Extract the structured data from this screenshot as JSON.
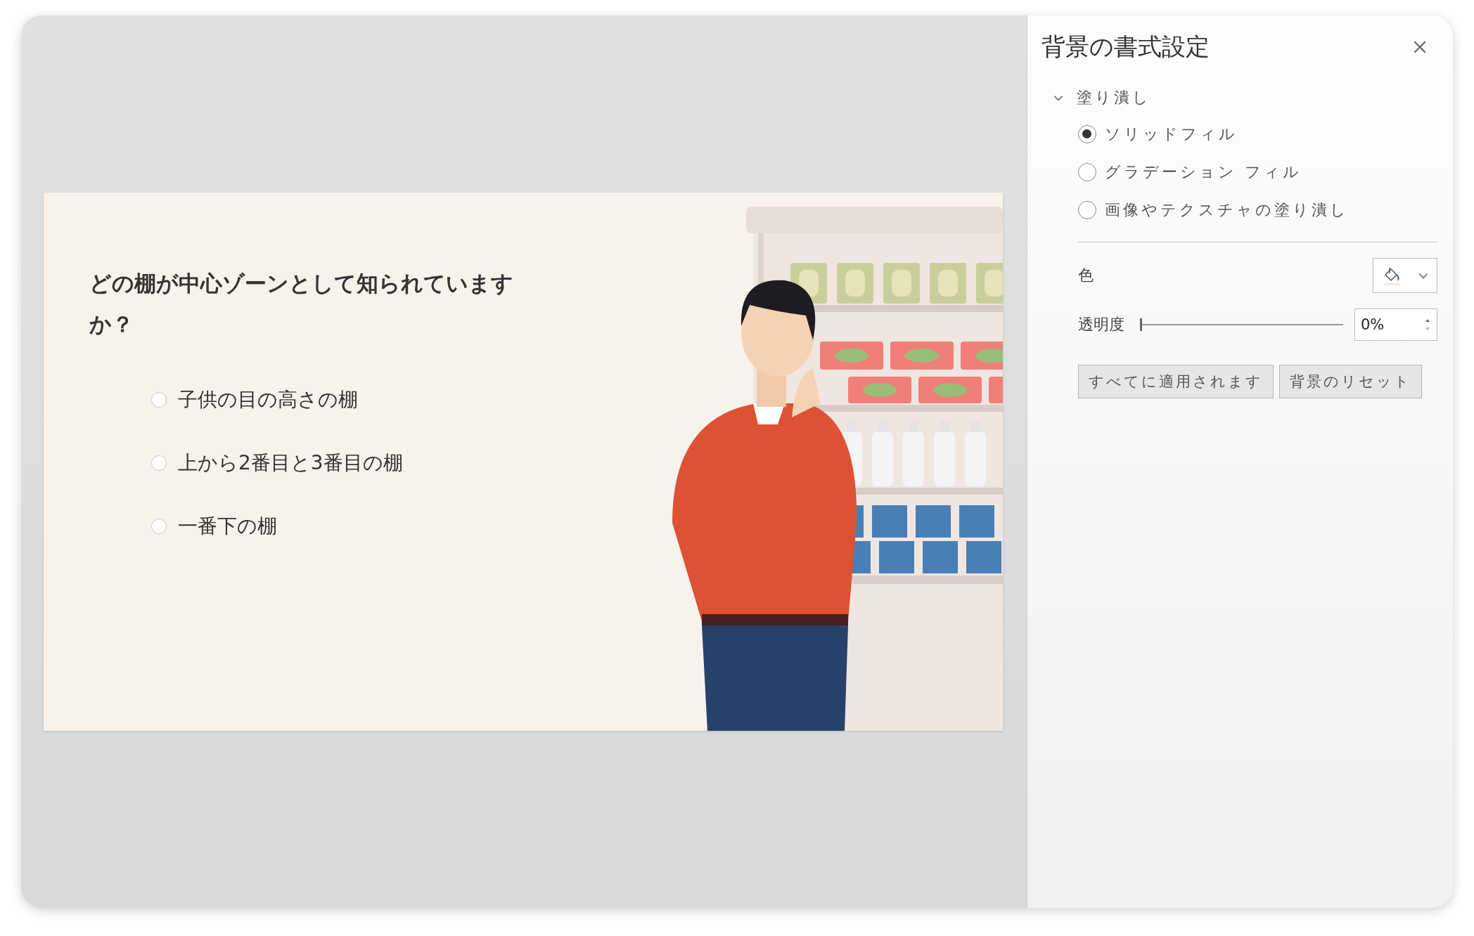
{
  "slide": {
    "question": "どの棚が中心ゾーンとして知られていますか？",
    "options": [
      {
        "label": "子供の目の高さの棚",
        "selected": false
      },
      {
        "label": "上から2番目と3番目の棚",
        "selected": false
      },
      {
        "label": "一番下の棚",
        "selected": false
      }
    ]
  },
  "panel": {
    "title": "背景の書式設定",
    "section": {
      "label": "塗り潰し",
      "expanded": true
    },
    "fill_options": [
      {
        "label": "ソリッドフィル",
        "selected": true
      },
      {
        "label": "グラデーション フィル",
        "selected": false
      },
      {
        "label": "画像やテクスチャの塗り潰し",
        "selected": false
      }
    ],
    "color": {
      "label": "色"
    },
    "transparency": {
      "label": "透明度",
      "level": 0,
      "value": "0%"
    },
    "buttons": [
      "すべてに適用されます",
      "背景のリセット"
    ]
  }
}
